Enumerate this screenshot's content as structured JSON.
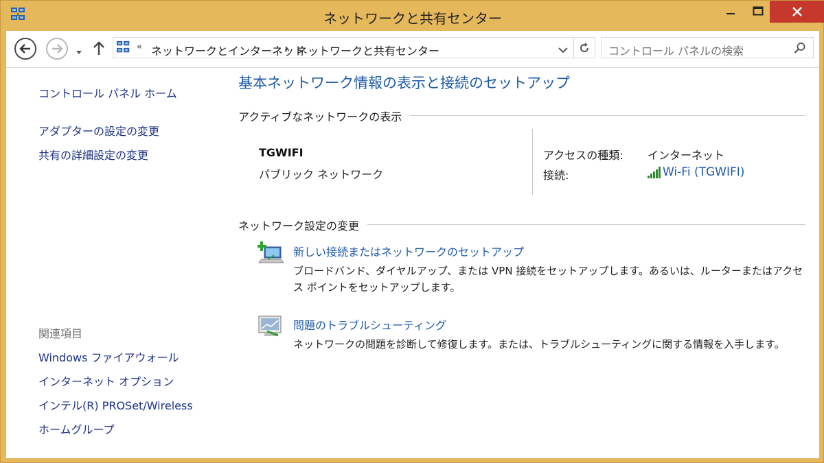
{
  "window": {
    "title": "ネットワークと共有センター"
  },
  "addressbar": {
    "overflow": "«",
    "crumbs": [
      "ネットワークとインターネット",
      "ネットワークと共有センター"
    ],
    "search_placeholder": "コントロール パネルの検索"
  },
  "sidebar": {
    "home": "コントロール パネル ホーム",
    "items": [
      "アダプターの設定の変更",
      "共有の詳細設定の変更"
    ],
    "related_heading": "関連項目",
    "related": [
      "Windows ファイアウォール",
      "インターネット オプション",
      "インテル(R) PROSet/Wireless",
      "ホームグループ"
    ]
  },
  "main": {
    "title": "基本ネットワーク情報の表示と接続のセットアップ",
    "active_section": "アクティブなネットワークの表示",
    "network": {
      "name": "TGWIFI",
      "type": "パブリック ネットワーク",
      "access_label": "アクセスの種類:",
      "access_value": "インターネット",
      "conn_label": "接続:",
      "conn_value": "Wi-Fi (TGWIFI)"
    },
    "change_section": "ネットワーク設定の変更",
    "tasks": [
      {
        "title": "新しい接続またはネットワークのセットアップ",
        "desc": "ブロードバンド、ダイヤルアップ、または VPN 接続をセットアップします。あるいは、ルーターまたはアクセス ポイントをセットアップします。"
      },
      {
        "title": "問題のトラブルシューティング",
        "desc": "ネットワークの問題を診断して修復します。または、トラブルシューティングに関する情報を入手します。"
      }
    ]
  },
  "colors": {
    "frame": "#e5b85c",
    "close_button": "#c6382b",
    "link": "#1e5aa8"
  }
}
